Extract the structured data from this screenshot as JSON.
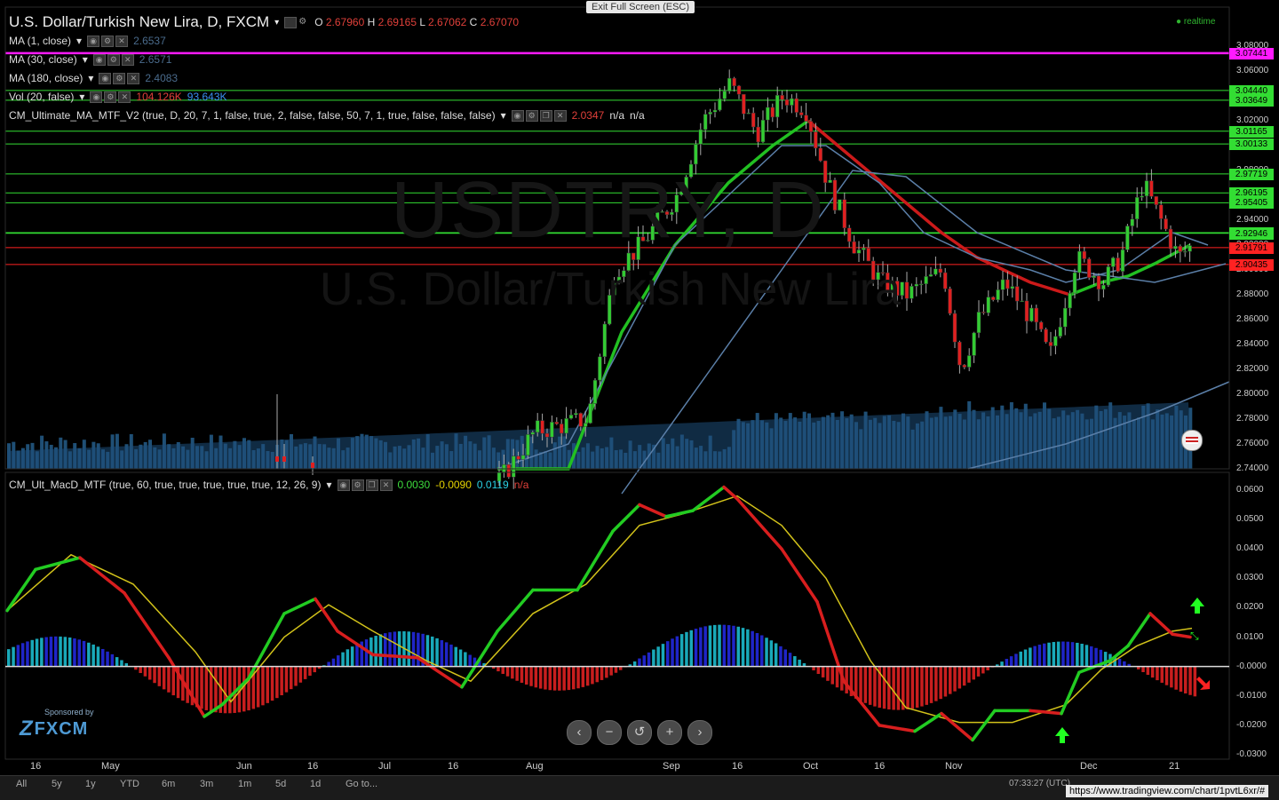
{
  "window": {
    "exit_fullscreen": "Exit Full Screen (ESC)",
    "realtime": "realtime",
    "url": "https://www.tradingview.com/chart/1pvtL6xr/#",
    "watermark_symbol": "USDTRY, D",
    "watermark_name": "U.S. Dollar/Turkish New Lira"
  },
  "header": {
    "symbol_title": "U.S. Dollar/Turkish New Lira, D, FXCM",
    "o_label": "O",
    "o_value": "2.67960",
    "h_label": "H",
    "h_value": "2.69165",
    "l_label": "L",
    "l_value": "2.67062",
    "c_label": "C",
    "c_value": "2.67070"
  },
  "indicators": [
    {
      "label": "MA (1, close)",
      "value": "2.6537"
    },
    {
      "label": "MA (30, close)",
      "value": "2.6571"
    },
    {
      "label": "MA (180, close)",
      "value": "2.4083"
    },
    {
      "label": "Vol (20, false)",
      "value": "104.126K",
      "value2": "93.643K"
    },
    {
      "label": "CM_Ultimate_MA_MTF_V2 (true, D, 20, 7, 1, false, true, 2, false, false, 50, 7, 1, true, false, false, false)",
      "value": "2.0347",
      "value2": "n/a",
      "value3": "n/a"
    }
  ],
  "macd_header": {
    "label": "CM_Ult_MacD_MTF (true, 60, true, true, true, true, true, 12, 26, 9)",
    "v1": "0.0030",
    "v2": "-0.0090",
    "v3": "0.0119",
    "v4": "n/a"
  },
  "price_axis": {
    "ticks": [
      "3.08000",
      "3.06000",
      "3.04000",
      "3.02000",
      "3.00000",
      "2.98000",
      "2.96000",
      "2.94000",
      "2.92000",
      "2.90000",
      "2.88000",
      "2.86000",
      "2.84000",
      "2.82000",
      "2.80000",
      "2.78000",
      "2.76000",
      "2.74000"
    ],
    "labels": [
      {
        "text": "3.07441",
        "color": "#ff1aff"
      },
      {
        "text": "3.04440",
        "color": "#33dd33"
      },
      {
        "text": "3.03649",
        "color": "#33dd33"
      },
      {
        "text": "3.01165",
        "color": "#33dd33"
      },
      {
        "text": "3.00133",
        "color": "#33dd33"
      },
      {
        "text": "2.97719",
        "color": "#33dd33"
      },
      {
        "text": "2.96195",
        "color": "#33dd33"
      },
      {
        "text": "2.95405",
        "color": "#33dd33"
      },
      {
        "text": "2.92998",
        "color": "#33dd33"
      },
      {
        "text": "2.92946",
        "color": "#33dd33"
      },
      {
        "text": "2.91791",
        "color": "#ff2222"
      },
      {
        "text": "2.90435",
        "color": "#ff2222"
      }
    ]
  },
  "macd_axis": {
    "ticks": [
      "0.0600",
      "0.0500",
      "0.0400",
      "0.0300",
      "0.0200",
      "0.0100",
      "-0.0000",
      "-0.0100",
      "-0.0200",
      "-0.0300"
    ]
  },
  "time_axis": {
    "labels": [
      "16",
      "May",
      "Jun",
      "16",
      "Jul",
      "16",
      "Aug",
      "Sep",
      "16",
      "Oct",
      "16",
      "Nov",
      "Dec",
      "21"
    ]
  },
  "bottom_bar": {
    "ranges": [
      "All",
      "5y",
      "1y",
      "YTD",
      "6m",
      "3m",
      "1m",
      "5d",
      "1d",
      "Go to..."
    ],
    "time": "07:33:27 (UTC)"
  },
  "nav_buttons": [
    "‹",
    "−",
    "↺",
    "+",
    "›"
  ],
  "sponsor": {
    "line1": "Sponsored by",
    "line2": "FXCM"
  },
  "colors": {
    "up": "#33cc33",
    "down": "#e02020",
    "ma_green": "#22c022",
    "ma_red": "#cc1a1a",
    "ma_blue": "#5b7fa8",
    "vol": "#1f4f75",
    "macd_up": "#22cc22",
    "macd_down": "#d81e1e",
    "signal": "#d2c21a",
    "hist_cyan": "#19a9b9",
    "hist_blue": "#1f25c8",
    "hist_red": "#c81e1e"
  },
  "chart_data": {
    "type": "candlestick",
    "title": "U.S. Dollar/Turkish New Lira, D, FXCM",
    "ylim": [
      2.74,
      3.09
    ],
    "series": [
      {
        "name": "MA (30, close)",
        "values": [
          2.76,
          2.78,
          2.86,
          2.98,
          3.03,
          3.02,
          2.99,
          2.95,
          2.91,
          2.89,
          2.88,
          2.88,
          2.89,
          2.9
        ]
      },
      {
        "name": "MA (180, close)",
        "values": [
          2.74,
          2.75,
          2.76,
          2.78,
          2.82,
          2.86,
          2.88,
          2.89,
          2.9,
          2.9,
          2.89,
          2.89,
          2.9,
          2.9
        ]
      }
    ],
    "macd": {
      "ylim": [
        -0.03,
        0.063
      ]
    }
  }
}
